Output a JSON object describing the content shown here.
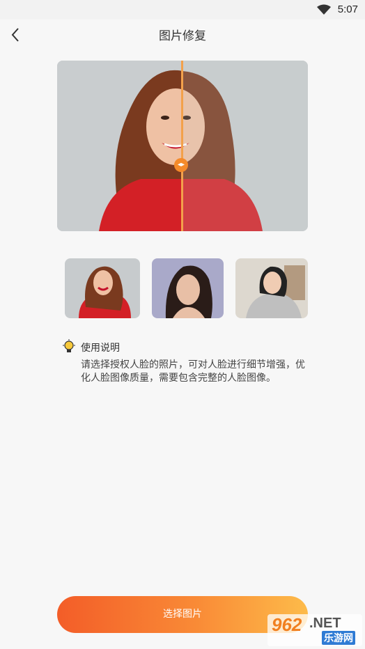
{
  "status_bar": {
    "time": "5:07",
    "wifi_icon": "wifi-icon"
  },
  "header": {
    "title": "图片修复",
    "back_icon": "chevron-left-icon"
  },
  "comparison": {
    "handle_icon": "arrows-left-right-icon",
    "split_position": 0.5
  },
  "samples": [
    {
      "icon": "sample-photo-red-sweater",
      "selected": true
    },
    {
      "icon": "sample-photo-portrait"
    },
    {
      "icon": "sample-photo-smiling-woman"
    }
  ],
  "tips": {
    "icon": "lightbulb-icon",
    "title": "使用说明",
    "body": "请选择授权人脸的照片，可对人脸进行细节增强，优化人脸图像质量，需要包含完整的人脸图像。"
  },
  "cta": {
    "label": "选择图片"
  },
  "watermark": {
    "number": "962",
    "net": ".NET",
    "cn": "乐游网"
  },
  "colors": {
    "accent": "#f58a2a",
    "cta_start": "#f35d28",
    "cta_end": "#fdbb4a"
  }
}
